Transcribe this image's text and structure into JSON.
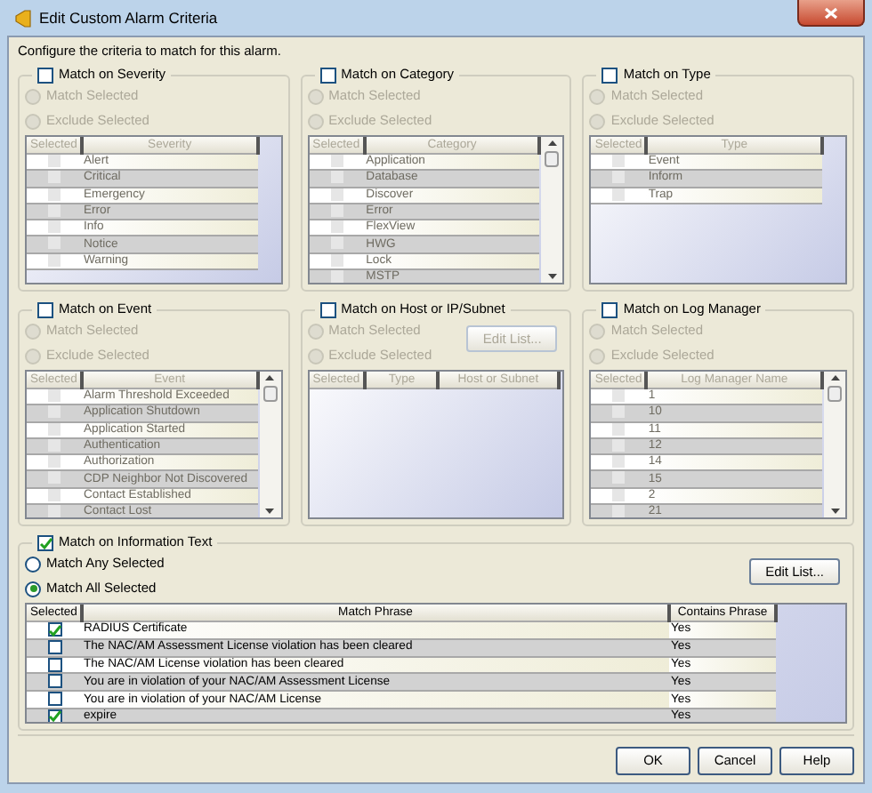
{
  "window": {
    "title": "Edit Custom Alarm Criteria"
  },
  "instruction": "Configure the criteria to match for this alarm.",
  "panels": [
    {
      "label": "Match on Severity",
      "checked": false,
      "disabled": true,
      "scrollable": false,
      "radios": [
        {
          "label": "Match Selected",
          "selected": false
        },
        {
          "label": "Exclude Selected",
          "selected": false
        }
      ],
      "columns": [
        "Selected",
        "Severity"
      ],
      "rows": [
        {
          "checked": false,
          "name": "Alert"
        },
        {
          "checked": false,
          "name": "Critical"
        },
        {
          "checked": false,
          "name": "Emergency"
        },
        {
          "checked": false,
          "name": "Error"
        },
        {
          "checked": false,
          "name": "Info"
        },
        {
          "checked": false,
          "name": "Notice"
        },
        {
          "checked": false,
          "name": "Warning"
        }
      ]
    },
    {
      "label": "Match on Category",
      "checked": false,
      "disabled": true,
      "scrollable": true,
      "radios": [
        {
          "label": "Match Selected",
          "selected": false
        },
        {
          "label": "Exclude Selected",
          "selected": false
        }
      ],
      "columns": [
        "Selected",
        "Category"
      ],
      "rows": [
        {
          "checked": false,
          "name": "Application"
        },
        {
          "checked": false,
          "name": "Database"
        },
        {
          "checked": false,
          "name": "Discover"
        },
        {
          "checked": false,
          "name": "Error"
        },
        {
          "checked": false,
          "name": "FlexView"
        },
        {
          "checked": false,
          "name": "HWG"
        },
        {
          "checked": false,
          "name": "Lock"
        },
        {
          "checked": false,
          "name": "MSTP"
        }
      ]
    },
    {
      "label": "Match on Type",
      "checked": false,
      "disabled": true,
      "scrollable": false,
      "radios": [
        {
          "label": "Match Selected",
          "selected": false
        },
        {
          "label": "Exclude Selected",
          "selected": false
        }
      ],
      "columns": [
        "Selected",
        "Type"
      ],
      "rows": [
        {
          "checked": false,
          "name": "Event"
        },
        {
          "checked": false,
          "name": "Inform"
        },
        {
          "checked": false,
          "name": "Trap"
        }
      ]
    },
    {
      "label": "Match on Event",
      "checked": false,
      "disabled": true,
      "scrollable": true,
      "radios": [
        {
          "label": "Match Selected",
          "selected": false
        },
        {
          "label": "Exclude Selected",
          "selected": false
        }
      ],
      "columns": [
        "Selected",
        "Event"
      ],
      "rows": [
        {
          "checked": false,
          "name": "Alarm Threshold Exceeded"
        },
        {
          "checked": false,
          "name": "Application Shutdown"
        },
        {
          "checked": false,
          "name": "Application Started"
        },
        {
          "checked": false,
          "name": "Authentication"
        },
        {
          "checked": false,
          "name": "Authorization"
        },
        {
          "checked": false,
          "name": "CDP Neighbor Not Discovered"
        },
        {
          "checked": false,
          "name": "Contact Established"
        },
        {
          "checked": false,
          "name": "Contact Lost"
        }
      ]
    },
    {
      "label": "Match on Host or IP/Subnet",
      "checked": false,
      "disabled": true,
      "scrollable": false,
      "radios": [
        {
          "label": "Match Selected",
          "selected": false
        },
        {
          "label": "Exclude Selected",
          "selected": false
        }
      ],
      "edit_button": {
        "label": "Edit List...",
        "disabled": true
      },
      "columns": [
        "Selected",
        "Type",
        "Host or Subnet"
      ]
    },
    {
      "label": "Match on Log Manager",
      "checked": false,
      "disabled": true,
      "scrollable": true,
      "radios": [
        {
          "label": "Match Selected",
          "selected": false
        },
        {
          "label": "Exclude Selected",
          "selected": false
        }
      ],
      "columns": [
        "Selected",
        "Log Manager Name"
      ],
      "rows": [
        {
          "checked": false,
          "name": "1"
        },
        {
          "checked": false,
          "name": "10"
        },
        {
          "checked": false,
          "name": "11"
        },
        {
          "checked": false,
          "name": "12"
        },
        {
          "checked": false,
          "name": "14"
        },
        {
          "checked": false,
          "name": "15"
        },
        {
          "checked": false,
          "name": "2"
        },
        {
          "checked": false,
          "name": "21"
        }
      ]
    }
  ],
  "info_panel": {
    "label": "Match on Information Text",
    "checked": true,
    "disabled": false,
    "scrollable": false,
    "radios": [
      {
        "label": "Match Any Selected",
        "selected": false
      },
      {
        "label": "Match All Selected",
        "selected": true
      }
    ],
    "edit_button": {
      "label": "Edit List...",
      "disabled": false
    },
    "columns": [
      "Selected",
      "Match Phrase",
      "Contains Phrase"
    ],
    "rows": [
      {
        "checked": true,
        "phrase": "RADIUS Certificate",
        "contains": "Yes"
      },
      {
        "checked": false,
        "phrase": "The NAC/AM Assessment License violation has been cleared",
        "contains": "Yes"
      },
      {
        "checked": false,
        "phrase": "The NAC/AM License violation has been cleared",
        "contains": "Yes"
      },
      {
        "checked": false,
        "phrase": "You are in violation of your NAC/AM Assessment License",
        "contains": "Yes"
      },
      {
        "checked": false,
        "phrase": "You are in violation of your NAC/AM License",
        "contains": "Yes"
      },
      {
        "checked": true,
        "phrase": "expire",
        "contains": "Yes"
      }
    ]
  },
  "buttons": [
    "OK",
    "Cancel",
    "Help"
  ]
}
